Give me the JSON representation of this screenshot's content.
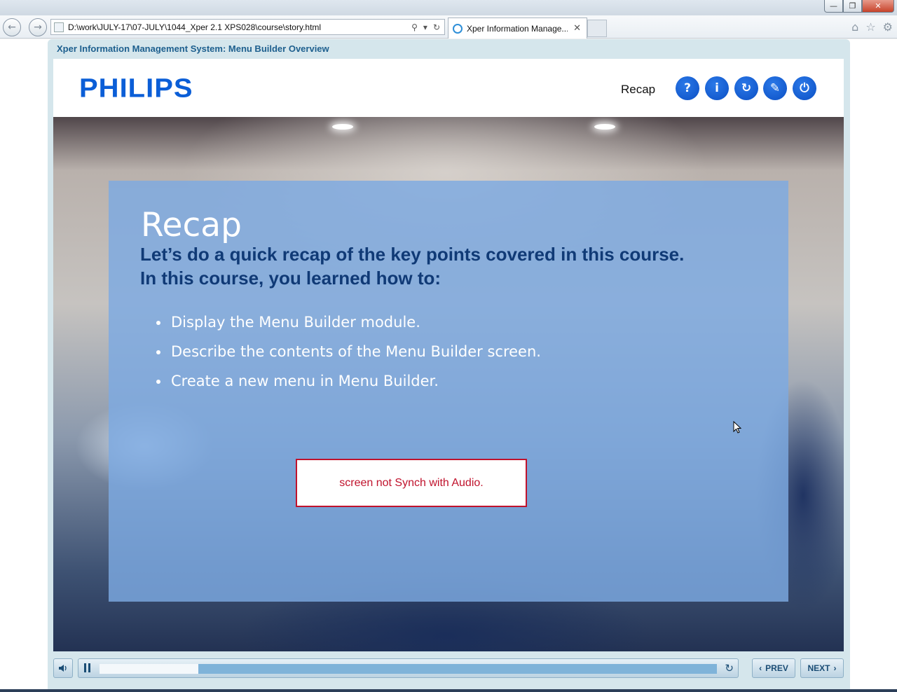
{
  "browser": {
    "address": "D:\\work\\JULY-17\\07-JULY\\1044_Xper 2.1 XPS028\\course\\story.html",
    "tab_title": "Xper Information Manage...",
    "window_controls": {
      "minimize": "—",
      "restore": "❐",
      "close": "✕"
    },
    "icons": {
      "back": "back-arrow-icon",
      "forward": "forward-arrow-icon",
      "search": "search-icon",
      "refresh": "refresh-icon",
      "home": "home-icon",
      "favorites": "star-icon",
      "settings": "gear-icon"
    }
  },
  "course": {
    "title": "Xper Information Management System: Menu Builder Overview",
    "logo": "PHILIPS",
    "header_title": "Recap",
    "header_buttons": [
      {
        "icon": "help-icon",
        "glyph": "?"
      },
      {
        "icon": "info-icon",
        "glyph": "i"
      },
      {
        "icon": "replay-icon",
        "glyph": "↻"
      },
      {
        "icon": "pen-icon",
        "glyph": "✎"
      },
      {
        "icon": "power-icon",
        "glyph": "⏻"
      }
    ]
  },
  "slide": {
    "heading": "Recap",
    "intro_line_1": "Let’s do a quick recap of the key points covered in this course.",
    "intro_line_2": "In this course, you learned how to:",
    "bullets": [
      "Display the Menu Builder module.",
      "Describe the contents of the Menu Builder screen.",
      "Create a new menu in Menu Builder."
    ],
    "review_note": "screen not Synch with Audio."
  },
  "player": {
    "progress": 0.16,
    "prev_label": "PREV",
    "next_label": "NEXT"
  },
  "colors": {
    "brand_blue": "#0b5ed7",
    "panel_overlay": "#7caae2",
    "note_red": "#c0122c"
  }
}
